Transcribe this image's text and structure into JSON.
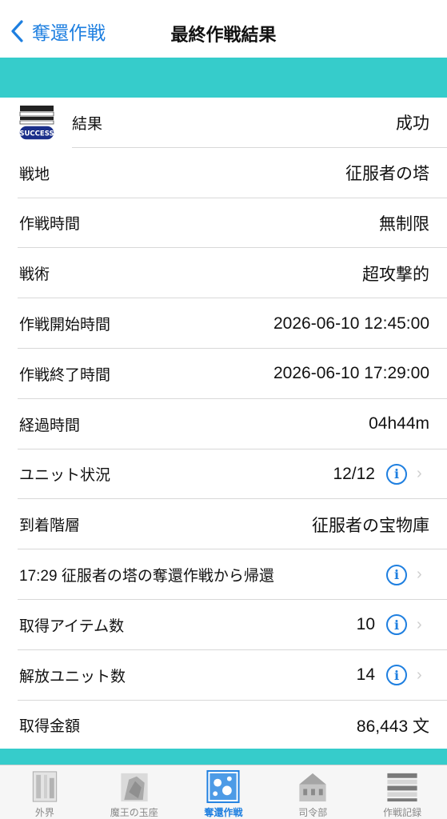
{
  "nav": {
    "back_label": "奪還作戦",
    "title": "最終作戦結果"
  },
  "result_icon_text": "SUCCESS",
  "rows": [
    {
      "label": "結果",
      "value": "成功"
    },
    {
      "label": "戦地",
      "value": "征服者の塔"
    },
    {
      "label": "作戦時間",
      "value": "無制限"
    },
    {
      "label": "戦術",
      "value": "超攻撃的"
    },
    {
      "label": "作戦開始時間",
      "value": "2026-06-10 12:45:00"
    },
    {
      "label": "作戦終了時間",
      "value": "2026-06-10 17:29:00"
    },
    {
      "label": "経過時間",
      "value": "04h44m"
    },
    {
      "label": "ユニット状況",
      "value": "12/12"
    },
    {
      "label": "到着階層",
      "value": "征服者の宝物庫"
    },
    {
      "label": "17:29 征服者の塔の奪還作戦から帰還",
      "value": ""
    },
    {
      "label": "取得アイテム数",
      "value": "10"
    },
    {
      "label": "解放ユニット数",
      "value": "14"
    },
    {
      "label": "取得金額",
      "value": "86,443 文"
    }
  ],
  "tabs": [
    {
      "label": "外界",
      "icon": "outer-world-icon"
    },
    {
      "label": "魔王の玉座",
      "icon": "throne-icon"
    },
    {
      "label": "奪還作戦",
      "icon": "recapture-icon",
      "active": true
    },
    {
      "label": "司令部",
      "icon": "headquarters-icon"
    },
    {
      "label": "作戦記録",
      "icon": "records-icon"
    }
  ],
  "colors": {
    "accent": "#1e7fe0",
    "teal": "#36cccb"
  }
}
